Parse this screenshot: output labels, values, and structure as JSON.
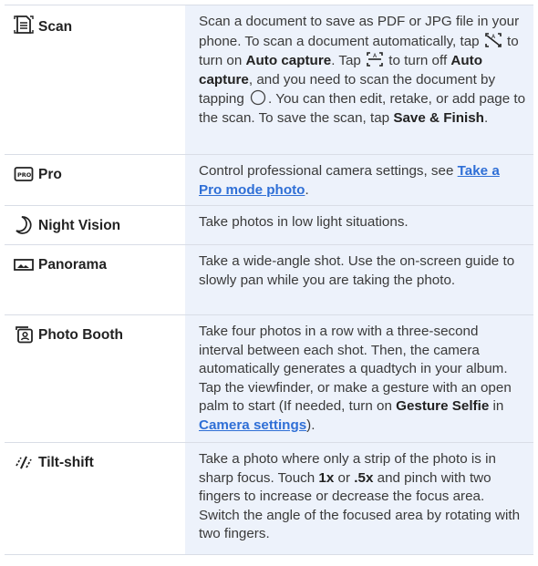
{
  "rows": [
    {
      "name": "Scan",
      "icon": "scan-doc-icon",
      "p1": "Scan a document to save as PDF or JPG file in your phone. To scan a document automatically, tap ",
      "p2": " to turn on ",
      "b1": "Auto capture",
      "p3": ". Tap ",
      "p4": " to turn off ",
      "b2": "Auto capture",
      "p5": ", and you need to scan the document by tapping ",
      "p6": ". You can then edit, retake, or add page to the scan. To save the scan, tap ",
      "b3": "Save & Finish",
      "p7": "."
    },
    {
      "name": "Pro",
      "icon": "pro-icon",
      "p1": "Control professional camera settings, see ",
      "link": "Take a Pro mode photo",
      "p2": "."
    },
    {
      "name": "Night Vision",
      "icon": "moon-icon",
      "p1": "Take photos in low light situations."
    },
    {
      "name": "Panorama",
      "icon": "panorama-icon",
      "p1": "Take a wide-angle shot. Use the on-screen guide to slowly pan while you are taking the photo."
    },
    {
      "name": "Photo Booth",
      "icon": "photo-booth-icon",
      "p1": "Take four photos in a row with a three-second interval between each shot. Then, the camera automatically generates a quadtych in your album. Tap the viewfinder, or make a gesture with an open palm to start (If needed, turn on ",
      "b1": "Gesture Selfie",
      "p2": " in ",
      "link": "Camera settings",
      "p3": ")."
    },
    {
      "name": "Tilt-shift",
      "icon": "tilt-shift-icon",
      "p1": "Take a photo where only a strip of the photo is in sharp focus. Touch ",
      "b1": "1x",
      "p2": " or ",
      "b2": ".5x",
      "p3": " and pinch with two fingers to increase or decrease the focus area. Switch the angle of the focused area by rotating with two fingers."
    }
  ],
  "colors": {
    "desc_bg": "#edf2fb",
    "border": "#d9dde6",
    "link": "#2f6fd6"
  }
}
